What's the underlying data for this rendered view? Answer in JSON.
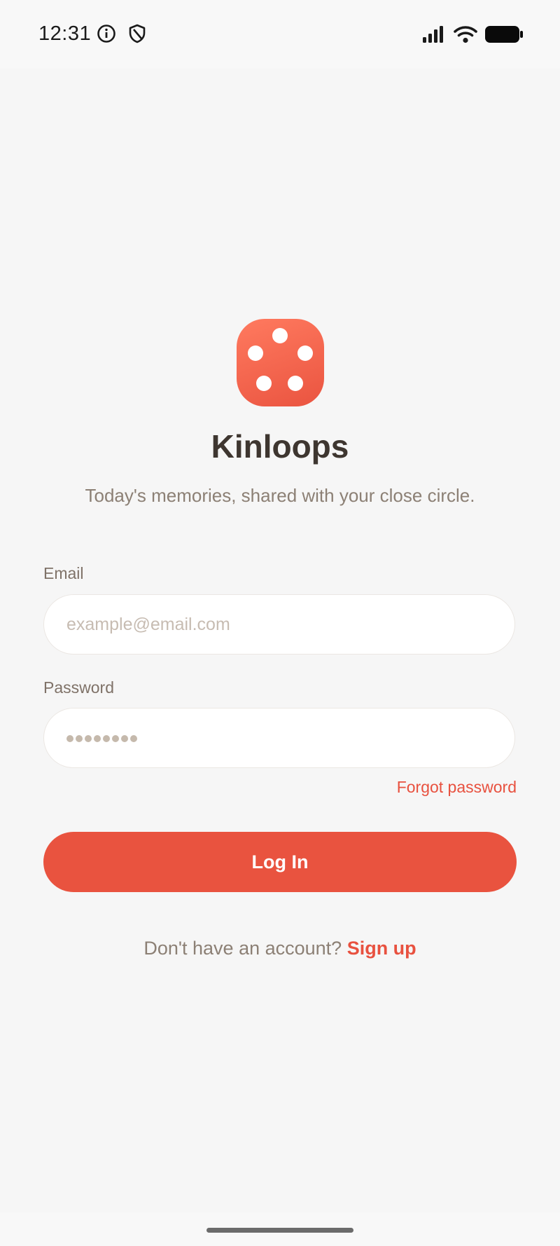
{
  "status_bar": {
    "time": "12:31",
    "left_icons": [
      "info-icon",
      "shield-icon"
    ],
    "right_icons": [
      "signal-icon",
      "wifi-icon",
      "battery-icon"
    ]
  },
  "branding": {
    "logo_icon": "dots-logo-icon",
    "app_name": "Kinloops",
    "tagline": "Today's memories, shared with your close circle."
  },
  "form": {
    "email_label": "Email",
    "email_placeholder": "example@email.com",
    "email_value": "",
    "password_label": "Password",
    "password_masked_length": 8,
    "forgot_password": "Forgot password",
    "login_button": "Log In"
  },
  "signup": {
    "prompt": "Don't have an account?",
    "link": "Sign up"
  },
  "colors": {
    "accent": "#e9533f",
    "background": "#f6f6f6",
    "title": "#3e3630",
    "muted_text": "#8c8075"
  }
}
